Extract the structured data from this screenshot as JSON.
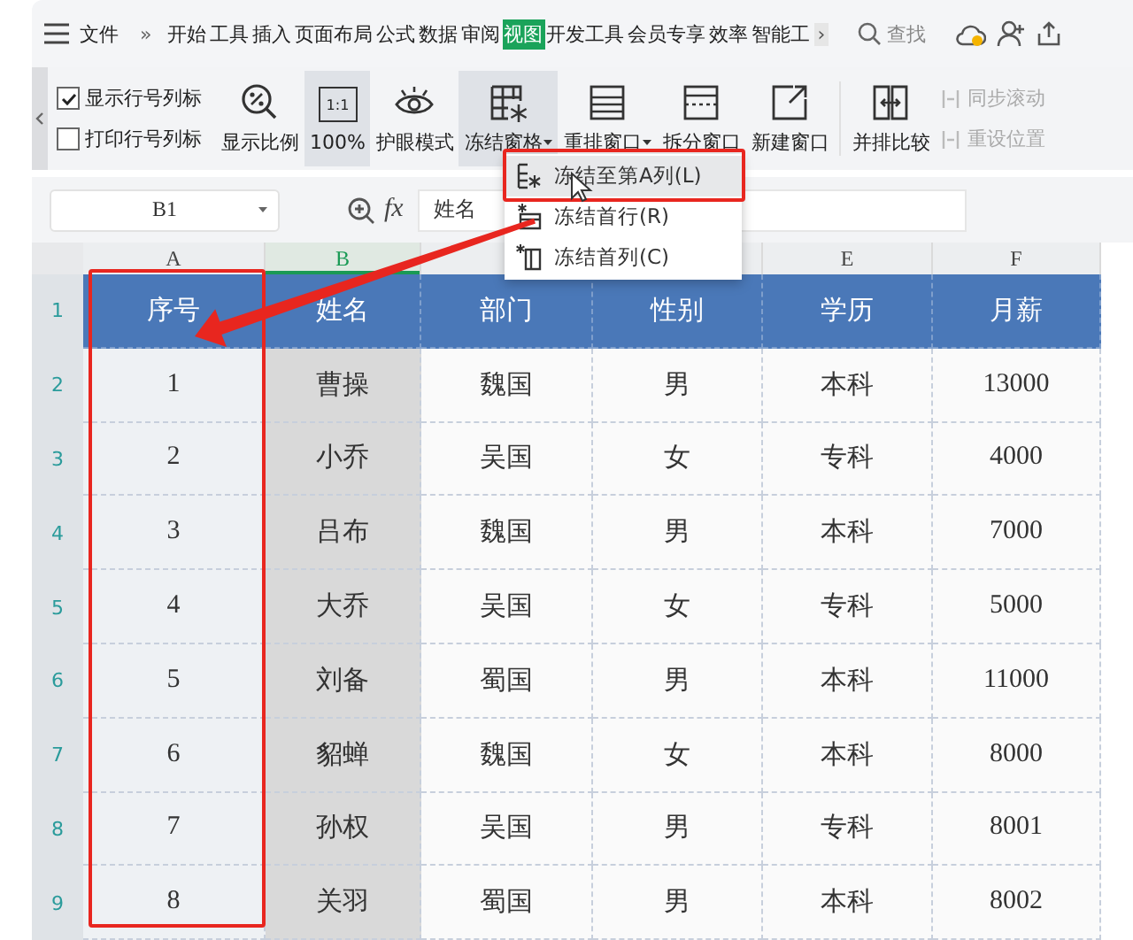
{
  "tabbar": {
    "file_menu": "文件",
    "more": "»",
    "tabs": [
      {
        "label": "开始",
        "selected": false
      },
      {
        "label": "工具",
        "selected": false
      },
      {
        "label": "插入",
        "selected": false
      },
      {
        "label": "页面布局",
        "selected": false
      },
      {
        "label": "公式",
        "selected": false
      },
      {
        "label": "数据",
        "selected": false
      },
      {
        "label": "审阅",
        "selected": false
      },
      {
        "label": "视图",
        "selected": true
      },
      {
        "label": "开发工具",
        "selected": false
      },
      {
        "label": "会员专享",
        "selected": false
      },
      {
        "label": "效率",
        "selected": false
      },
      {
        "label": "智能工",
        "selected": false
      }
    ],
    "overflow": "›",
    "search": {
      "placeholder": "查找"
    }
  },
  "ribbon": {
    "checkboxes": [
      {
        "label": "显示行号列标",
        "checked": true
      },
      {
        "label": "打印行号列标",
        "checked": false
      }
    ],
    "buttons": [
      {
        "label": "显示比例",
        "pressed": false,
        "dropdown": false
      },
      {
        "label": "100%",
        "icon_text": "1:1",
        "pressed": true,
        "dropdown": false
      },
      {
        "label": "护眼模式",
        "pressed": false,
        "dropdown": false
      },
      {
        "label": "冻结窗格",
        "pressed": true,
        "dropdown": true
      },
      {
        "label": "重排窗口",
        "pressed": false,
        "dropdown": true
      },
      {
        "label": "拆分窗口",
        "pressed": false,
        "dropdown": false
      },
      {
        "label": "新建窗口",
        "pressed": false,
        "dropdown": false
      },
      {
        "label": "并排比较",
        "pressed": false,
        "dropdown": false
      }
    ],
    "side_items": [
      {
        "label": "同步滚动",
        "disabled": true
      },
      {
        "label": "重设位置",
        "disabled": true
      }
    ]
  },
  "formula_bar": {
    "name_box": "B1",
    "function_label": "fx",
    "formula": "姓名"
  },
  "freeze_menu": {
    "items": [
      {
        "label": "冻结至第A列(L)",
        "highlighted": true
      },
      {
        "label": "冻结首行(R)",
        "highlighted": false
      },
      {
        "label": "冻结首列(C)",
        "highlighted": false
      }
    ]
  },
  "sheet": {
    "columns": [
      {
        "label": "A",
        "selected": false
      },
      {
        "label": "B",
        "selected": true
      },
      {
        "selected": false
      },
      {
        "selected": false
      },
      {
        "label": "E",
        "selected": false
      },
      {
        "label": "F",
        "selected": false
      }
    ],
    "rows": [
      {
        "number": "1",
        "kind": "header",
        "cells": [
          "序号",
          "姓名",
          "部门",
          "性别",
          "学历",
          "月薪"
        ]
      },
      {
        "number": "2",
        "kind": "data",
        "cells": [
          "1",
          "曹操",
          "魏国",
          "男",
          "本科",
          "13000"
        ]
      },
      {
        "number": "3",
        "kind": "data",
        "cells": [
          "2",
          "小乔",
          "吴国",
          "女",
          "专科",
          "4000"
        ]
      },
      {
        "number": "4",
        "kind": "data",
        "cells": [
          "3",
          "吕布",
          "魏国",
          "男",
          "本科",
          "7000"
        ]
      },
      {
        "number": "5",
        "kind": "data",
        "cells": [
          "4",
          "大乔",
          "吴国",
          "女",
          "专科",
          "5000"
        ]
      },
      {
        "number": "6",
        "kind": "data",
        "cells": [
          "5",
          "刘备",
          "蜀国",
          "男",
          "本科",
          "11000"
        ]
      },
      {
        "number": "7",
        "kind": "data",
        "cells": [
          "6",
          "貂蝉",
          "魏国",
          "女",
          "本科",
          "8000"
        ]
      },
      {
        "number": "8",
        "kind": "data",
        "cells": [
          "7",
          "孙权",
          "吴国",
          "男",
          "专科",
          "8001"
        ]
      },
      {
        "number": "9",
        "kind": "data",
        "cells": [
          "8",
          "关羽",
          "蜀国",
          "男",
          "本科",
          "8002"
        ]
      }
    ]
  }
}
